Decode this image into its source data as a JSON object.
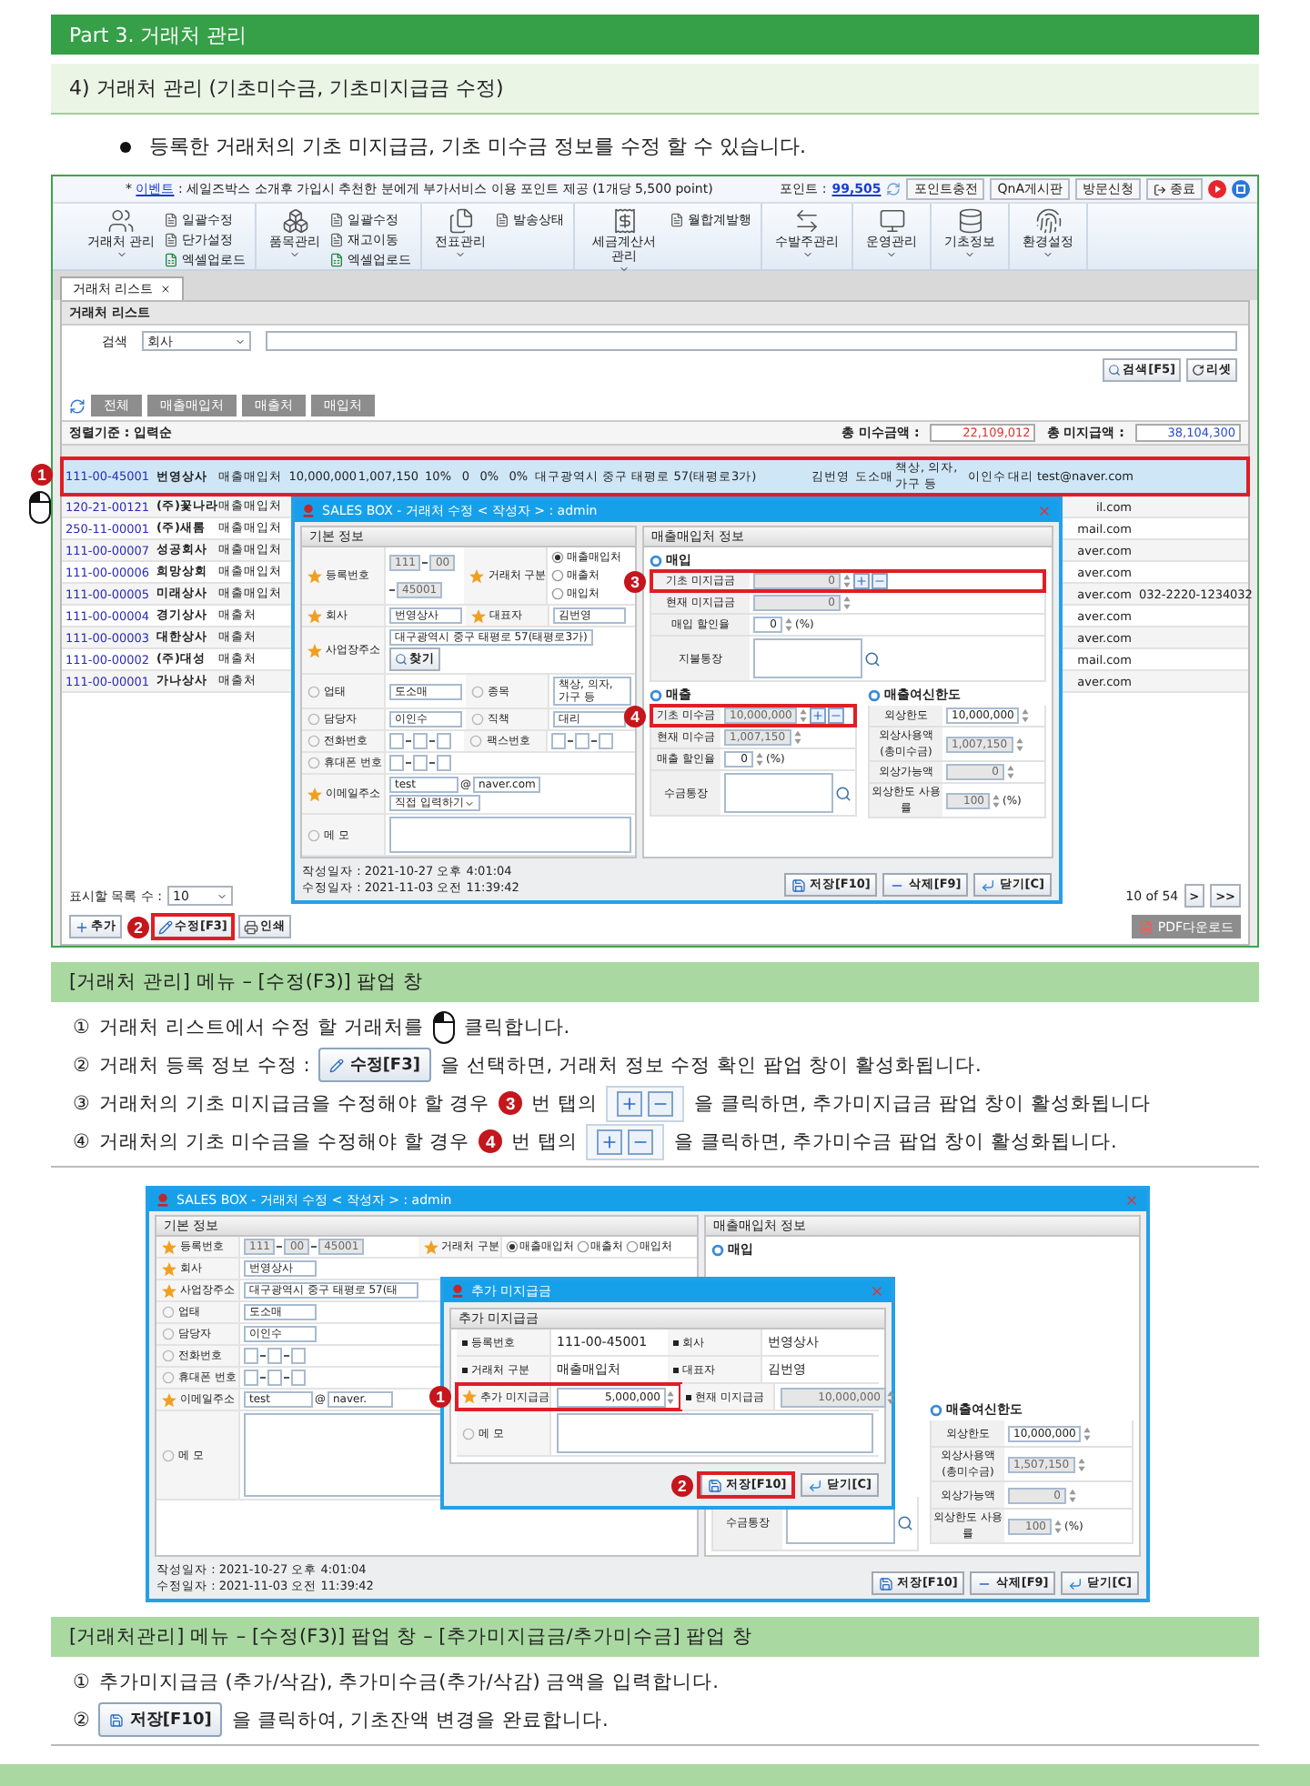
{
  "header": "Part 3. 거래처 관리",
  "subheader": "4) 거래처 관리 (기초미수금, 기초미지급금 수정)",
  "bullet": "등록한 거래처의 기초 미지급금, 기초 미수금 정보를 수정 할 수 있습니다.",
  "screenshot_1": {
    "top_bar": {
      "notice": [
        {
          "kind": "text",
          "text": "* "
        },
        {
          "kind": "link",
          "text": "이벤트"
        },
        {
          "kind": "text",
          "text": " : 세일즈박스 소개후 가입시 추천한 분에게 부가서비스 이용 포인트 제공 (1개당 5,500 point)"
        }
      ],
      "points_label": "포인트 :",
      "points": "99,505",
      "buttons": [
        "포인트충전",
        "QnA게시판",
        "방문신청",
        "종료"
      ]
    },
    "ribbon": [
      {
        "label": "거래처 관리",
        "items": [
          {
            "label": "일괄수정",
            "kind": "doc"
          },
          {
            "label": "단가설정",
            "kind": "doc"
          },
          {
            "label": "엑셀업로드",
            "kind": "excel"
          }
        ]
      },
      {
        "label": "품목관리",
        "items": [
          {
            "label": "일괄수정",
            "kind": "doc"
          },
          {
            "label": "재고이동",
            "kind": "doc"
          },
          {
            "label": "엑셀업로드",
            "kind": "excel"
          }
        ]
      },
      {
        "label": "전표관리",
        "items": [
          {
            "label": "발송상태",
            "kind": "doc"
          }
        ]
      },
      {
        "label": "세금계산서 관리",
        "items": [
          {
            "label": "월합계발행",
            "kind": "doc"
          }
        ]
      },
      {
        "label": "수발주관리"
      },
      {
        "label": "운영관리"
      },
      {
        "label": "기초정보"
      },
      {
        "label": "환경설정"
      }
    ],
    "tab": "거래처 리스트",
    "list": {
      "title": "거래처 리스트",
      "search_label": "검색",
      "search_field": "회사",
      "search_button": "검색[F5]",
      "reset_button": "리셋",
      "filters": [
        "전체",
        "매출매입처",
        "매출처",
        "매입처"
      ],
      "sort": "정렬기준 : 입력순",
      "totals": [
        {
          "label": "총 미수금액 :",
          "value": "22,109,012",
          "kind": "receivable"
        },
        {
          "label": "총 미지급액 :",
          "value": "38,104,300",
          "kind": "payable"
        }
      ],
      "rows": [
        {
          "selected": true,
          "badge": "1",
          "cells": [
            "111-00-45001",
            "번영상사",
            "매출매입처",
            "10,000,000",
            "1,007,150",
            "10%",
            "0",
            "0%",
            "0%",
            "대구광역시 중구 태평로 57(태평로3가)",
            "김번영",
            "도소매",
            "책상, 의자, 가구 등",
            "이인수",
            "대리",
            "test@naver.com"
          ]
        },
        {
          "selected": false,
          "cells": [
            "120-21-00121",
            "(주)꽃나라",
            "매출매입처"
          ],
          "tail": [
            "il.com"
          ]
        },
        {
          "selected": false,
          "cells": [
            "250-11-00001",
            "(주)새롬",
            "매출매입처"
          ],
          "tail": [
            "mail.com"
          ]
        },
        {
          "selected": false,
          "cells": [
            "111-00-00007",
            "성공회사",
            "매출매입처"
          ],
          "tail": [
            "aver.com"
          ]
        },
        {
          "selected": false,
          "cells": [
            "111-00-00006",
            "희망상회",
            "매출매입처"
          ],
          "tail": [
            "aver.com"
          ]
        },
        {
          "selected": false,
          "cells": [
            "111-00-00005",
            "미래상사",
            "매출매입처"
          ],
          "tail": [
            "aver.com",
            "032-2220-1234",
            "032"
          ]
        },
        {
          "selected": false,
          "cells": [
            "111-00-00004",
            "경기상사",
            "매출처"
          ],
          "tail": [
            "aver.com"
          ]
        },
        {
          "selected": false,
          "cells": [
            "111-00-00003",
            "대한상사",
            "매출처"
          ],
          "tail": [
            "aver.com"
          ]
        },
        {
          "selected": false,
          "cells": [
            "111-00-00002",
            "(주)대성",
            "매출처"
          ],
          "tail": [
            "mail.com"
          ]
        },
        {
          "selected": false,
          "cells": [
            "111-00-00001",
            "가나상사",
            "매출처"
          ],
          "tail": [
            "aver.com"
          ]
        }
      ],
      "page_size_label": "표시할 목록 수 :",
      "page_size": "10",
      "pager": "10 of 54",
      "pager_buttons": [
        ">",
        ">>"
      ],
      "buttons": [
        {
          "label": "추가",
          "kind": "add"
        },
        {
          "label": "수정[F3]",
          "kind": "edit",
          "badge": "2"
        },
        {
          "label": "인쇄",
          "kind": "print"
        }
      ],
      "pdf_button": "PDF다운로드"
    },
    "dialog": {
      "title": "SALES BOX - 거래처 수정 < 작성자 > : admin",
      "basic": {
        "title": "기본 정보",
        "rows": [
          {
            "cells": [
              {
                "label": "등록번호",
                "required": true,
                "kind": "split",
                "parts": [
                  "111",
                  "00",
                  "45001"
                ]
              },
              {
                "label": "거래처 구분",
                "required": true,
                "kind": "radio",
                "options": [
                  {
                    "label": "매출매입처",
                    "selected": true
                  },
                  {
                    "label": "매출처",
                    "selected": false
                  },
                  {
                    "label": "매입처",
                    "selected": false
                  }
                ]
              }
            ]
          },
          {
            "cells": [
              {
                "label": "회사",
                "required": true,
                "kind": "input",
                "value": "번영상사"
              },
              {
                "label": "대표자",
                "required": true,
                "kind": "input",
                "value": "김번영"
              }
            ]
          },
          {
            "cells": [
              {
                "label": "사업장주소",
                "required": true,
                "kind": "address",
                "value": "대구광역시 중구 태평로 57(태평로3가)",
                "button": "찾기"
              }
            ]
          },
          {
            "cells": [
              {
                "label": "업태",
                "required": false,
                "kind": "input",
                "value": "도소매"
              },
              {
                "label": "종목",
                "required": false,
                "kind": "input",
                "value": "책상, 의자, 가구 등"
              }
            ]
          },
          {
            "cells": [
              {
                "label": "담당자",
                "required": false,
                "kind": "input",
                "value": "이인수"
              },
              {
                "label": "직책",
                "required": false,
                "kind": "input",
                "value": "대리"
              }
            ]
          },
          {
            "cells": [
              {
                "label": "전화번호",
                "required": false,
                "kind": "phone"
              },
              {
                "label": "팩스번호",
                "required": false,
                "kind": "phone"
              }
            ]
          },
          {
            "cells": [
              {
                "label": "휴대폰 번호",
                "required": false,
                "kind": "phone"
              }
            ]
          },
          {
            "cells": [
              {
                "label": "이메일주소",
                "required": true,
                "kind": "email",
                "user": "test",
                "at": "@",
                "domain": "naver.com",
                "select": "직접 입력하기"
              }
            ]
          },
          {
            "cells": [
              {
                "label": "메 모",
                "required": false,
                "kind": "memo"
              }
            ]
          }
        ]
      },
      "account": {
        "title": "매출매입처 정보",
        "purchase": {
          "title": "매입",
          "rows": [
            {
              "label": "기초 미지급금",
              "kind": "adjust",
              "value": "0",
              "disabled": true,
              "badge": "3"
            },
            {
              "label": "현재 미지급금",
              "kind": "amount",
              "value": "0",
              "disabled": true
            },
            {
              "label": "매입 할인율",
              "kind": "percent",
              "value": "0",
              "unit": "(%)",
              "disabled": false
            },
            {
              "label": "지불통장",
              "kind": "memo"
            }
          ]
        },
        "sales": {
          "title": "매출",
          "rows": [
            {
              "label": "기초 미수금",
              "kind": "adjust",
              "value": "10,000,000",
              "disabled": true,
              "badge": "4"
            },
            {
              "label": "현재 미수금",
              "kind": "amount",
              "value": "1,007,150",
              "disabled": true
            },
            {
              "label": "매출 할인율",
              "kind": "percent",
              "value": "0",
              "unit": "(%)",
              "disabled": false
            },
            {
              "label": "수금통장",
              "kind": "memo"
            }
          ]
        },
        "credit": {
          "title": "매출여신한도",
          "rows": [
            {
              "label": "외상한도",
              "kind": "amount",
              "value": "10,000,000",
              "disabled": false
            },
            {
              "label": "외상사용액 (총미수금)",
              "kind": "amount",
              "value": "1,007,150",
              "disabled": true
            },
            {
              "label": "외상가능액",
              "kind": "amount",
              "value": "0",
              "disabled": true
            },
            {
              "label": "외상한도 사용률",
              "kind": "percent",
              "value": "100",
              "unit": "(%)",
              "disabled": true
            }
          ]
        }
      },
      "created": "작성일자 : 2021-10-27 오후 4:01:04",
      "modified": "수정일자 : 2021-11-03 오전 11:39:42",
      "buttons": [
        {
          "label": "저장[F10]",
          "kind": "save"
        },
        {
          "label": "삭제[F9]",
          "kind": "delete"
        },
        {
          "label": "닫기[C]",
          "kind": "close"
        }
      ]
    }
  },
  "section_1": {
    "title": "[거래처 관리] 메뉴 – [수정(F3)] 팝업 창",
    "steps": [
      {
        "number": "①",
        "parts": [
          {
            "kind": "text",
            "text": "거래처 리스트에서 수정 할 거래처를"
          },
          {
            "kind": "mouse"
          },
          {
            "kind": "text",
            "text": "클릭합니다."
          }
        ]
      },
      {
        "number": "②",
        "parts": [
          {
            "kind": "text",
            "text": "거래처 등록 정보 수정 :"
          },
          {
            "kind": "edit_button",
            "label": "수정[F3]"
          },
          {
            "kind": "text",
            "text": "을 선택하면, 거래처 정보 수정 확인 팝업 창이 활성화됩니다."
          }
        ]
      },
      {
        "number": "③",
        "parts": [
          {
            "kind": "text",
            "text": "거래처의 기초 미지급금을 수정해야 할 경우"
          },
          {
            "kind": "badge",
            "text": "3"
          },
          {
            "kind": "text",
            "text": "번 탭의"
          },
          {
            "kind": "plusminus"
          },
          {
            "kind": "text",
            "text": "을 클릭하면,  추가미지급금  팝업 창이 활성화됩니다"
          }
        ]
      },
      {
        "number": "④",
        "parts": [
          {
            "kind": "text",
            "text": "거래처의 기초 미수금을 수정해야 할 경우"
          },
          {
            "kind": "badge",
            "text": "4"
          },
          {
            "kind": "text",
            "text": "번 탭의"
          },
          {
            "kind": "plusminus"
          },
          {
            "kind": "text",
            "text": "을 클릭하면, 추가미수금 팝업 창이 활성화됩니다."
          }
        ]
      }
    ]
  },
  "screenshot_2": {
    "dialog": {
      "title": "SALES BOX - 거래처 수정 < 작성자 > : admin",
      "basic": {
        "title": "기본 정보",
        "rows": [
          {
            "cells": [
              {
                "label": "등록번호",
                "required": true,
                "kind": "split",
                "parts": [
                  "111",
                  "00",
                  "45001"
                ]
              },
              {
                "label": "거래처 구분",
                "required": true,
                "kind": "radio",
                "options": [
                  {
                    "label": "매출매입처",
                    "selected": true
                  },
                  {
                    "label": "매출처",
                    "selected": false
                  },
                  {
                    "label": "매입처",
                    "selected": false
                  }
                ]
              }
            ]
          },
          {
            "cells": [
              {
                "label": "회사",
                "required": true,
                "kind": "input",
                "value": "번영상사"
              }
            ]
          },
          {
            "cells": [
              {
                "label": "사업장주소",
                "required": true,
                "kind": "address",
                "value": "대구광역시 중구 태평로 57(태"
              }
            ]
          },
          {
            "cells": [
              {
                "label": "업태",
                "required": false,
                "kind": "input",
                "value": "도소매"
              }
            ]
          },
          {
            "cells": [
              {
                "label": "담당자",
                "required": false,
                "kind": "input",
                "value": "이인수"
              }
            ]
          },
          {
            "cells": [
              {
                "label": "전화번호",
                "required": false,
                "kind": "phone"
              }
            ]
          },
          {
            "cells": [
              {
                "label": "휴대폰 번호",
                "required": false,
                "kind": "phone"
              }
            ]
          },
          {
            "cells": [
              {
                "label": "이메일주소",
                "required": true,
                "kind": "email",
                "user": "test",
                "at": "@",
                "domain": "naver."
              }
            ]
          },
          {
            "cells": [
              {
                "label": "메 모",
                "required": false,
                "kind": "memo"
              }
            ]
          }
        ]
      },
      "account": {
        "title": "매출매입처 정보",
        "purchase": {
          "title": "매입",
          "rows": [
            {
              "kind": "adjust"
            },
            {
              "kind": "amount"
            },
            {
              "kind": "percent"
            },
            {
              "kind": "memo"
            }
          ]
        },
        "sales": {
          "rows": [
            {
              "kind": "adjust"
            },
            {
              "kind": "amount"
            },
            {
              "kind": "percent"
            },
            {
              "label": "수금통장",
              "kind": "memo"
            }
          ]
        },
        "credit": {
          "title": "매출여신한도",
          "rows": [
            {
              "label": "외상한도",
              "kind": "amount",
              "value": "10,000,000",
              "disabled": false
            },
            {
              "label": "외상사용액 (총미수금)",
              "kind": "amount",
              "value": "1,507,150",
              "disabled": true
            },
            {
              "label": "외상가능액",
              "kind": "amount",
              "value": "0",
              "disabled": true
            },
            {
              "label": "외상한도 사용률",
              "kind": "percent",
              "value": "100",
              "unit": "(%)",
              "disabled": true
            }
          ]
        }
      },
      "created": "작성일자 : 2021-10-27 오후 4:01:04",
      "modified": "수정일자 : 2021-11-03 오전 11:39:42",
      "buttons": [
        {
          "label": "저장[F10]",
          "kind": "save"
        },
        {
          "label": "삭제[F9]",
          "kind": "delete"
        },
        {
          "label": "닫기[C]",
          "kind": "close"
        }
      ]
    },
    "popup": {
      "title": "추가 미지급금",
      "section": "추가 미지급금",
      "rows": [
        [
          {
            "label": "등록번호",
            "required": false,
            "kind": "text",
            "value": "111-00-45001"
          },
          {
            "label": "회사",
            "required": false,
            "kind": "text",
            "value": "번영상사"
          }
        ],
        [
          {
            "label": "거래처 구분",
            "required": false,
            "kind": "text",
            "value": "매출매입처"
          },
          {
            "label": "대표자",
            "required": false,
            "kind": "text",
            "value": "김번영"
          }
        ],
        [
          {
            "label": "추가 미지급금",
            "required": true,
            "kind": "spinner",
            "value": "5,000,000",
            "disabled": false,
            "badge": "1"
          },
          {
            "label": "현재 미지급금",
            "required": false,
            "kind": "spinner",
            "value": "10,000,000",
            "disabled": true
          }
        ],
        [
          {
            "label": "메 모",
            "required": false,
            "kind": "memo"
          }
        ]
      ],
      "buttons": [
        {
          "label": "저장[F10]",
          "kind": "save",
          "badge": "2"
        },
        {
          "label": "닫기[C]",
          "kind": "close"
        }
      ]
    }
  },
  "section_2": {
    "title": "[거래처관리] 메뉴 – [수정(F3)] 팝업 창 – [추가미지급금/추가미수금] 팝업 창",
    "steps": [
      {
        "number": "①",
        "parts": [
          {
            "kind": "text",
            "text": "추가미지급금 (추가/삭감), 추가미수금(추가/삭감) 금액을  입력합니다."
          }
        ]
      },
      {
        "number": "②",
        "parts": [
          {
            "kind": "save_button",
            "label": "저장[F10]"
          },
          {
            "kind": "text",
            "text": "을 클릭하여, 기초잔액 변경을 완료합니다."
          }
        ]
      }
    ]
  }
}
